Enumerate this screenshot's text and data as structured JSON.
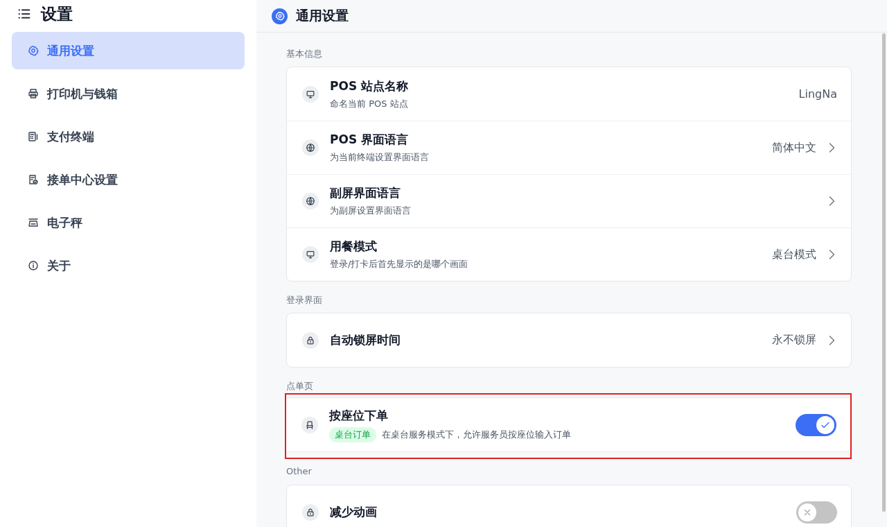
{
  "sidebar": {
    "title": "设置",
    "items": [
      {
        "label": "通用设置",
        "selected": true
      },
      {
        "label": "打印机与钱箱",
        "selected": false
      },
      {
        "label": "支付终端",
        "selected": false
      },
      {
        "label": "接单中心设置",
        "selected": false
      },
      {
        "label": "电子秤",
        "selected": false
      },
      {
        "label": "关于",
        "selected": false
      }
    ]
  },
  "header": {
    "title": "通用设置"
  },
  "sections": [
    {
      "label": "基本信息",
      "highlighted": false,
      "rows": [
        {
          "kind": "value",
          "title": "POS 站点名称",
          "subtitle": "命名当前 POS 站点",
          "value": "LingNa"
        },
        {
          "kind": "nav",
          "title": "POS 界面语言",
          "subtitle": "为当前终端设置界面语言",
          "value": "简体中文"
        },
        {
          "kind": "nav",
          "title": "副屏界面语言",
          "subtitle": "为副屏设置界面语言"
        },
        {
          "kind": "nav",
          "title": "用餐模式",
          "subtitle": "登录/打卡后首先显示的是哪个画面",
          "value": "桌台模式"
        }
      ]
    },
    {
      "label": "登录界面",
      "highlighted": false,
      "rows": [
        {
          "kind": "nav",
          "title": "自动锁屏时间",
          "value": "永不锁屏"
        }
      ]
    },
    {
      "label": "点单页",
      "highlighted": true,
      "rows": [
        {
          "kind": "switch",
          "title": "按座位下单",
          "tag": "桌台订单",
          "subtitle": "在桌台服务模式下，允许服务员按座位输入订单",
          "on": true
        }
      ]
    },
    {
      "label": "Other",
      "highlighted": false,
      "rows": [
        {
          "kind": "switch",
          "title": "减少动画",
          "on": false
        }
      ]
    }
  ]
}
